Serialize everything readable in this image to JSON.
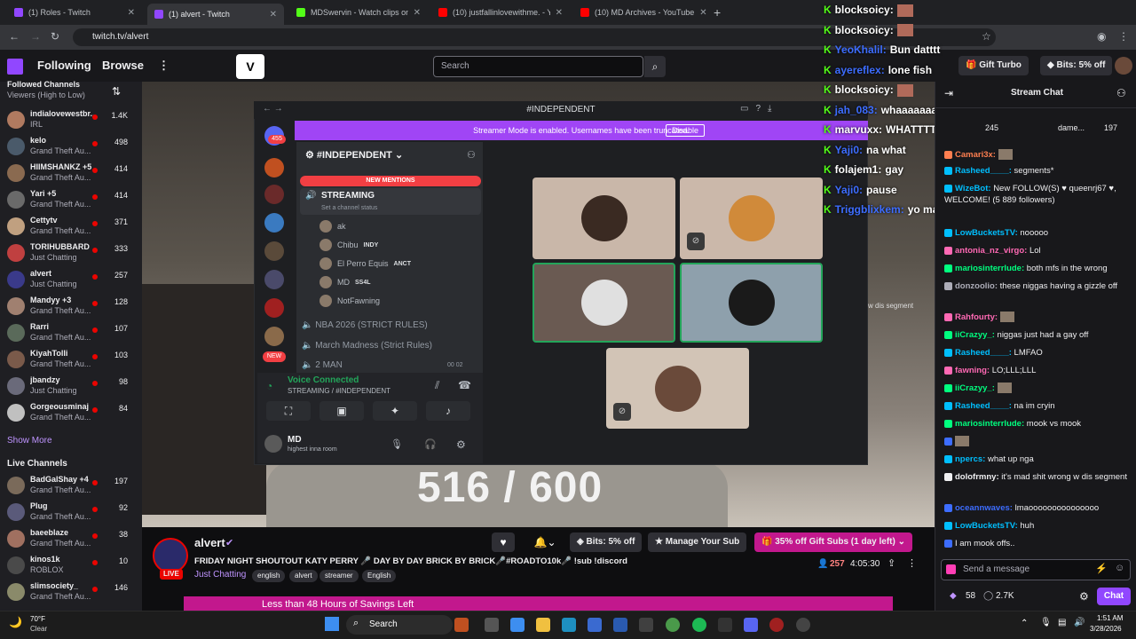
{
  "browser": {
    "tabs": [
      {
        "label": "(1) Roles - Twitch",
        "color": "#9147ff"
      },
      {
        "label": "(1) alvert - Twitch",
        "color": "#9147ff"
      },
      {
        "label": "MDSwervin - Watch clips on Ki",
        "color": "#53fc18"
      },
      {
        "label": "(10) justfallinlovewithme. - You",
        "color": "#ff0000"
      },
      {
        "label": "(10) MD Archives - YouTube",
        "color": "#ff0000"
      }
    ],
    "url": "twitch.tv/alvert"
  },
  "twitch": {
    "nav_following": "Following",
    "nav_browse": "Browse",
    "search_placeholder": "Search",
    "gift_turbo": "Gift Turbo",
    "bits_offer": "Bits: 5% off"
  },
  "sidebar": {
    "followed_title": "Followed Channels",
    "sort_label": "Viewers (High to Low)",
    "followed": [
      {
        "name": "indialovewestbr...",
        "category": "IRL",
        "viewers": "1.4K",
        "color": "#b07a60"
      },
      {
        "name": "kelo",
        "category": "Grand Theft Au...",
        "viewers": "498",
        "color": "#4a5a6a"
      },
      {
        "name": "HIIMSHANKZ +5",
        "category": "Grand Theft Au...",
        "viewers": "414",
        "color": "#8a6a50"
      },
      {
        "name": "Yari +5",
        "category": "Grand Theft Au...",
        "viewers": "414",
        "color": "#6a6a6a"
      },
      {
        "name": "Cettytv",
        "category": "Grand Theft Au...",
        "viewers": "371",
        "color": "#c0a080"
      },
      {
        "name": "TORIHUBBARD",
        "category": "Just Chatting",
        "viewers": "333",
        "color": "#c04040"
      },
      {
        "name": "alvert",
        "category": "Just Chatting",
        "viewers": "257",
        "color": "#3a3a8a"
      },
      {
        "name": "Mandyy +3",
        "category": "Grand Theft Au...",
        "viewers": "128",
        "color": "#a08070"
      },
      {
        "name": "Rarri",
        "category": "Grand Theft Au...",
        "viewers": "107",
        "color": "#5a6a5a"
      },
      {
        "name": "KiyahTolli",
        "category": "Grand Theft Au...",
        "viewers": "103",
        "color": "#7a5a4a"
      },
      {
        "name": "jbandzy",
        "category": "Just Chatting",
        "viewers": "98",
        "color": "#6a6a7a"
      },
      {
        "name": "Gorgeousminaj",
        "category": "Grand Theft Au...",
        "viewers": "84",
        "color": "#c0c0c0"
      }
    ],
    "show_more": "Show More",
    "live_title": "Live Channels",
    "live": [
      {
        "name": "BadGalShay +4",
        "category": "Grand Theft Au...",
        "viewers": "197",
        "color": "#7a6a5a"
      },
      {
        "name": "Plug",
        "category": "Grand Theft Au...",
        "viewers": "92",
        "color": "#5a5a7a"
      },
      {
        "name": "baeeblaze",
        "category": "Grand Theft Au...",
        "viewers": "38",
        "color": "#a07060"
      },
      {
        "name": "kinos1k",
        "category": "ROBLOX",
        "viewers": "10",
        "color": "#4a4a4a"
      },
      {
        "name": "slimsociety_",
        "category": "Grand Theft Au...",
        "viewers": "146",
        "color": "#8a8a6a"
      }
    ]
  },
  "discord": {
    "window_title": "#INDEPENDENT",
    "streamer_mode": "Streamer Mode is enabled. Usernames have been truncated.",
    "disable_label": "Disable",
    "server_name": "#INDEPENDENT",
    "new_mentions": "NEW MENTIONS",
    "streaming_channel": "STREAMING",
    "channel_status": "Set a channel status",
    "voice_users": [
      {
        "name": "ak",
        "tag": ""
      },
      {
        "name": "Chibu",
        "tag": "INDY"
      },
      {
        "name": "El Perro Equis",
        "tag": "ANCT"
      },
      {
        "name": "MD",
        "tag": "SS4L"
      },
      {
        "name": "NotFawning",
        "tag": ""
      }
    ],
    "other_channels": [
      "NBA 2026 (STRICT RULES)",
      "March Madness (Strict Rules)",
      "2 MAN"
    ],
    "two_man_counts": "00  02",
    "guild_badge": "455",
    "new_badge": "NEW",
    "voice_connected": "Voice Connected",
    "voice_location": "STREAMING / #INDEPENDENT",
    "user_name": "MD",
    "user_status": "highest inna room"
  },
  "stream": {
    "overlay_text": "516 / 600",
    "segment_text": "w dis segment",
    "overlay_chat": [
      {
        "user": "blocksoicy:",
        "msg": "",
        "color": "#ffffff"
      },
      {
        "user": "blocksoicy:",
        "msg": "",
        "color": "#ffffff"
      },
      {
        "user": "YeoKhalil:",
        "msg": "Bun datttt",
        "color": "#3d6dff"
      },
      {
        "user": "ayereflex:",
        "msg": "lone fish",
        "color": "#3d6dff"
      },
      {
        "user": "blocksoicy:",
        "msg": "",
        "color": "#ffffff"
      },
      {
        "user": "jah_083:",
        "msg": "whaaaaaaaaaaaaaaaaaaaaaaaaaaaaaaaaa",
        "color": "#3d6dff"
      },
      {
        "user": "marvuxx:",
        "msg": "WHATTTTTT",
        "color": "#ffffff"
      },
      {
        "user": "Yaji0:",
        "msg": "na what",
        "color": "#3d6dff"
      },
      {
        "user": "folajem1:",
        "msg": "gay",
        "color": "#ffffff"
      },
      {
        "user": "Yaji0:",
        "msg": "pause",
        "color": "#3d6dff"
      },
      {
        "user": "Triggblixkem:",
        "msg": "yo man",
        "color": "#3d6dff"
      }
    ]
  },
  "chat": {
    "title": "Stream Chat",
    "pinned_count": "245",
    "pinned_user": "dame...",
    "pinned_bits": "197",
    "messages": [
      {
        "user": "Camari3x:",
        "msg": "",
        "color": "#ff7f50"
      },
      {
        "user": "Rasheed____:",
        "msg": "segments*",
        "color": "#00bfff"
      },
      {
        "user": "WizeBot:",
        "msg": "New FOLLOW(S) ♥ queenrj67 ♥, WELCOME! (5 889 followers)",
        "color": "#00bfff"
      },
      {
        "user": "LowBucketsTV:",
        "msg": "nooooo",
        "color": "#00bfff"
      },
      {
        "user": "antonia_nz_virgo:",
        "msg": "Lol",
        "color": "#ff69b4"
      },
      {
        "user": "mariosinterrlude:",
        "msg": "both mfs in the wrong",
        "color": "#00ff7f"
      },
      {
        "user": "donzoolio:",
        "msg": "these niggas having a gizzle off",
        "color": "#adadb8"
      },
      {
        "user": "Rahfourty:",
        "msg": "",
        "color": "#ff69b4"
      },
      {
        "user": "iiCrazyy_:",
        "msg": "niggas just had a gay off",
        "color": "#00ff7f"
      },
      {
        "user": "Rasheed____:",
        "msg": "LMFAO",
        "color": "#00bfff"
      },
      {
        "user": "fawning:",
        "msg": "LO;LLL;LLL",
        "color": "#ff69b4"
      },
      {
        "user": "iiCrazyy_:",
        "msg": "",
        "color": "#00ff7f"
      },
      {
        "user": "Rasheed____:",
        "msg": "na im cryin",
        "color": "#00bfff"
      },
      {
        "user": "mariosinterrlude:",
        "msg": "mook vs mook",
        "color": "#00ff7f"
      },
      {
        "user": "",
        "msg": "",
        "color": "#3d6dff"
      },
      {
        "user": "npercs:",
        "msg": "what up nga",
        "color": "#00bfff"
      },
      {
        "user": "dolofrmny:",
        "msg": "it's mad shit wrong w dis segment",
        "color": "#efeff1"
      },
      {
        "user": "oceannwaves:",
        "msg": "lmaooooooooooooooo",
        "color": "#3d6dff"
      },
      {
        "user": "LowBucketsTV:",
        "msg": "huh",
        "color": "#00bfff"
      },
      {
        "user": "",
        "msg": "I am mook offs..",
        "color": "#3d6dff"
      }
    ],
    "input_placeholder": "Send a message",
    "points_a": "58",
    "points_b": "2.7K",
    "chat_button": "Chat"
  },
  "channel_info": {
    "streamer": "alvert",
    "title": "FRIDAY NIGHT SHOUTOUT KATY PERRY 🎤 DAY BY DAY BRICK BY BRICK🎤#ROADTO10k🎤 !sub !discord",
    "category": "Just Chatting",
    "tags": [
      "english",
      "alvert",
      "streamer",
      "English"
    ],
    "live_label": "LIVE",
    "viewers": "257",
    "uptime": "4:05:30",
    "bits_button": "Bits: 5% off",
    "manage_sub": "Manage Your Sub",
    "gift_subs": "35% off Gift Subs (1 day left)",
    "promo": "Less than 48 Hours of Savings Left"
  },
  "taskbar": {
    "weather_temp": "70°F",
    "weather_desc": "Clear",
    "search": "Search",
    "time": "1:51 AM",
    "date": "3/28/2026"
  }
}
